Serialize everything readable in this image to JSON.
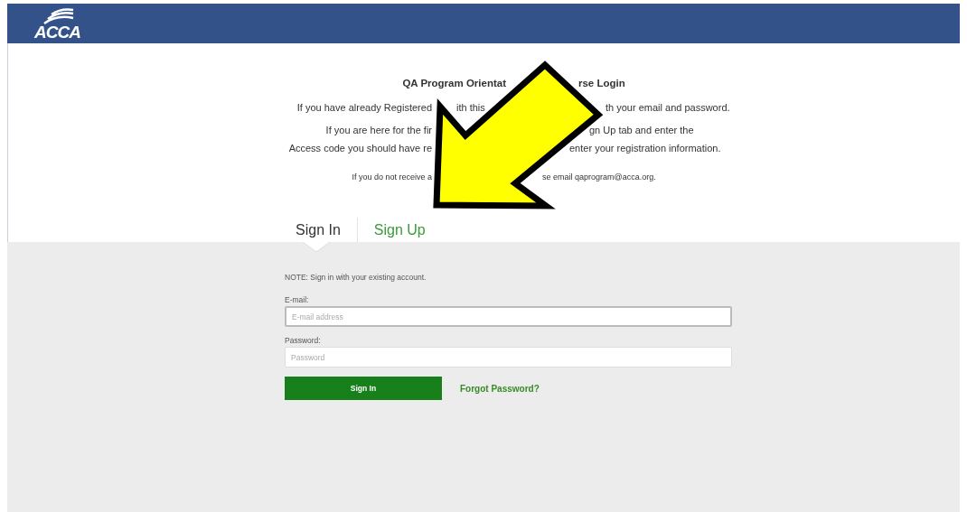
{
  "header": {
    "logo_text": "ACCA"
  },
  "intro": {
    "lines": [
      {
        "kind": "title",
        "parts": [
          "QA Program Orientat",
          "rse Login"
        ]
      },
      {
        "kind": "text",
        "parts": [
          "If you have already Registered",
          "ith this",
          "th your email and password."
        ]
      },
      {
        "kind": "text",
        "parts": [
          "If you are here for the fir",
          "gn Up tab and enter the"
        ]
      },
      {
        "kind": "text",
        "parts": [
          "Access code you should have re",
          "enter your registration information."
        ]
      },
      {
        "kind": "small",
        "parts": [
          "If you do not receive a",
          "se email qaprogram@acca.org."
        ]
      }
    ]
  },
  "tabs": [
    {
      "label": "Sign In",
      "selected": true
    },
    {
      "label": "Sign Up",
      "selected": false
    }
  ],
  "form": {
    "note": "NOTE: Sign in with your existing account.",
    "fields": [
      {
        "label": "E-mail:",
        "placeholder": "E-mail address",
        "focused": true
      },
      {
        "label": "Password:",
        "placeholder": "Password",
        "focused": false
      }
    ],
    "submit": "Sign In",
    "link": "Forgot Password?"
  }
}
